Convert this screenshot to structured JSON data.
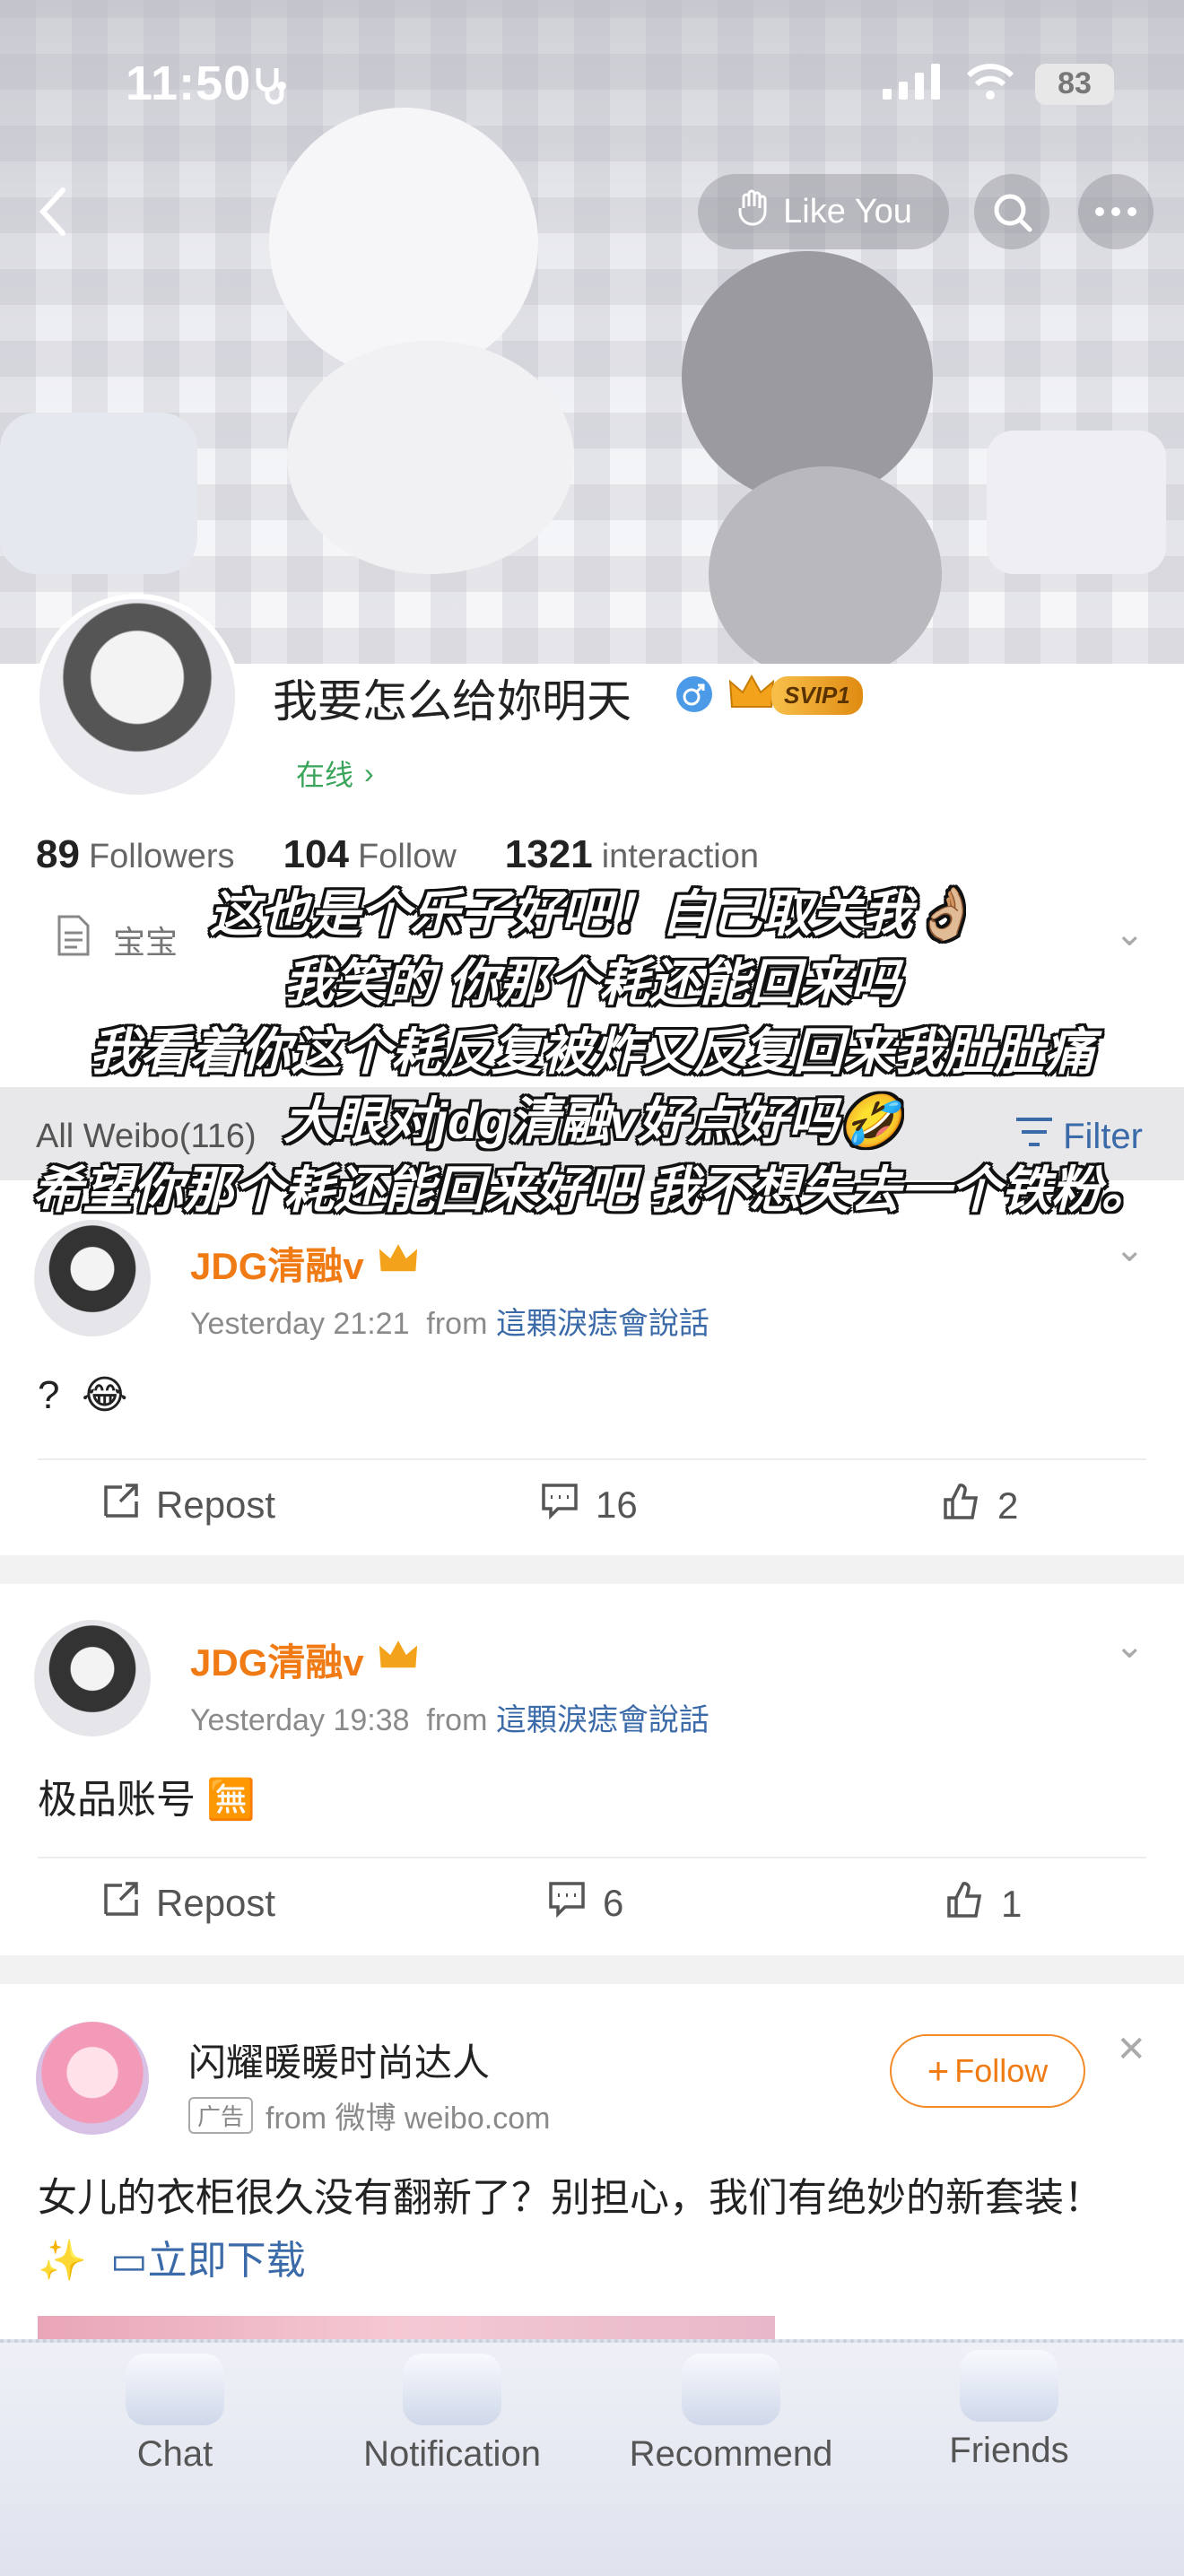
{
  "status_bar": {
    "time": "11:50",
    "battery": "83"
  },
  "nav": {
    "like_label": "Like You"
  },
  "profile": {
    "name": "我要怎么给妳明天",
    "vip_badge": "SVIP1",
    "online_status": "在线",
    "stats": [
      {
        "value": "89",
        "label": "Followers"
      },
      {
        "value": "104",
        "label": "Follow"
      },
      {
        "value": "1321",
        "label": "interaction"
      }
    ],
    "bio": "宝宝"
  },
  "caption_lines": [
    "这也是个乐子好吧！自己取关我👌🏼",
    "我笑的 你那个耗还能回来吗",
    "我看着你这个耗反复被炸又反复回来我肚肚痛",
    "大眼对jdg清融v好点好吗🤣",
    "希望你那个耗还能回来好吧 我不想失去一个铁粉。"
  ],
  "tabs": {
    "all_label": "All Weibo(116)",
    "filter_label": "Filter"
  },
  "posts": [
    {
      "author": "JDG清融v",
      "time": "Yesterday 21:21",
      "from_label": "from",
      "source": "這顆淚痣會說話",
      "text": "?",
      "emoji": "😂",
      "repost": "Repost",
      "comments": "16",
      "likes": "2"
    },
    {
      "author": "JDG清融v",
      "time": "Yesterday 19:38",
      "from_label": "from",
      "source": "這顆淚痣會說話",
      "text": "极品账号",
      "emoji": "🈚",
      "repost": "Repost",
      "comments": "6",
      "likes": "1"
    }
  ],
  "ad": {
    "author": "闪耀暖暖时尚达人",
    "tag": "广告",
    "source": "from 微博 weibo.com",
    "follow_label": "Follow",
    "text": "女儿的衣柜很久没有翻新了？别担心，我们有绝妙的新套装！",
    "sparkle": "✨",
    "link_label": "立即下载"
  },
  "bottom_nav": [
    {
      "label": "Chat"
    },
    {
      "label": "Notification"
    },
    {
      "label": "Recommend"
    },
    {
      "label": "Friends"
    }
  ],
  "colors": {
    "accent": "#f07a13",
    "link": "#3b6aa8",
    "online": "#3aa55a"
  }
}
